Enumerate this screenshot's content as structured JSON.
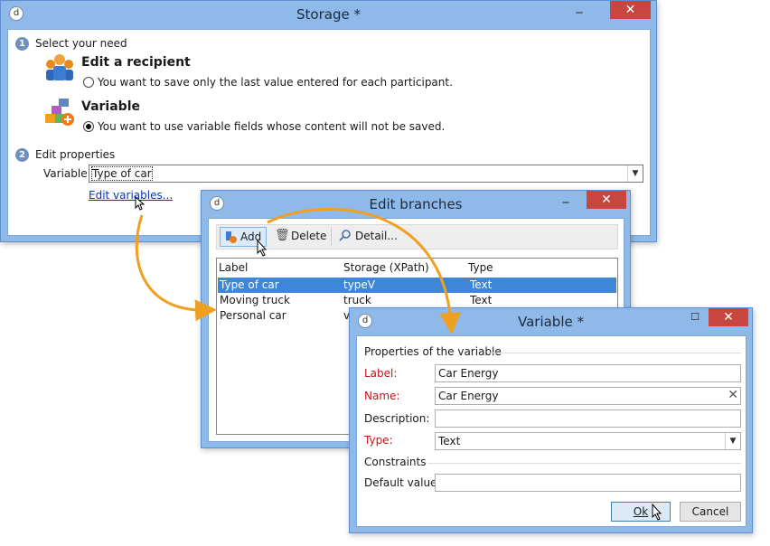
{
  "storage": {
    "title": "Storage *",
    "close_glyph": "✕",
    "step1": {
      "num": "1",
      "label": "Select your need"
    },
    "recipient": {
      "heading": "Edit a recipient",
      "radio_label": "You want to save only the last value entered for each participant.",
      "icon": "people-icon",
      "selected": false
    },
    "variable": {
      "heading": "Variable",
      "radio_label": "You want to use variable fields whose content will not be saved.",
      "icon": "variable-blocks-icon",
      "selected": true
    },
    "step2": {
      "num": "2",
      "label": "Edit properties"
    },
    "variable_field": {
      "label": "Variable:",
      "value": "Type of car"
    },
    "edit_link": "Edit variables..."
  },
  "edit_branches": {
    "title": "Edit branches",
    "toolbar": {
      "add": "Add",
      "delete": "Delete",
      "detail": "Detail..."
    },
    "columns": [
      "Label",
      "Storage (XPath)",
      "Type"
    ],
    "rows": [
      {
        "label": "Type of car",
        "xpath": "typeV",
        "type": "Text",
        "selected": true
      },
      {
        "label": "Moving truck",
        "xpath": "truck",
        "type": "Text",
        "selected": false
      },
      {
        "label": "Personal car",
        "xpath": "v",
        "type": "",
        "selected": false
      }
    ]
  },
  "variable_dialog": {
    "title": "Variable *",
    "section": "Properties of the variable",
    "fields": {
      "label": {
        "label": "Label:",
        "value": "Car Energy"
      },
      "name": {
        "label": "Name:",
        "value": "Car Energy"
      },
      "description": {
        "label": "Description:",
        "value": ""
      },
      "type": {
        "label": "Type:",
        "value": "Text"
      },
      "constraints": "Constraints",
      "default_value": {
        "label": "Default value:",
        "value": ""
      }
    },
    "ok": "Ok",
    "cancel": "Cancel"
  },
  "colors": {
    "title_bar": "#8fb9e8",
    "close_button": "#c7463f",
    "selection": "#3d86d8",
    "arrow": "#f0a020",
    "required_label": "#c4141b"
  }
}
